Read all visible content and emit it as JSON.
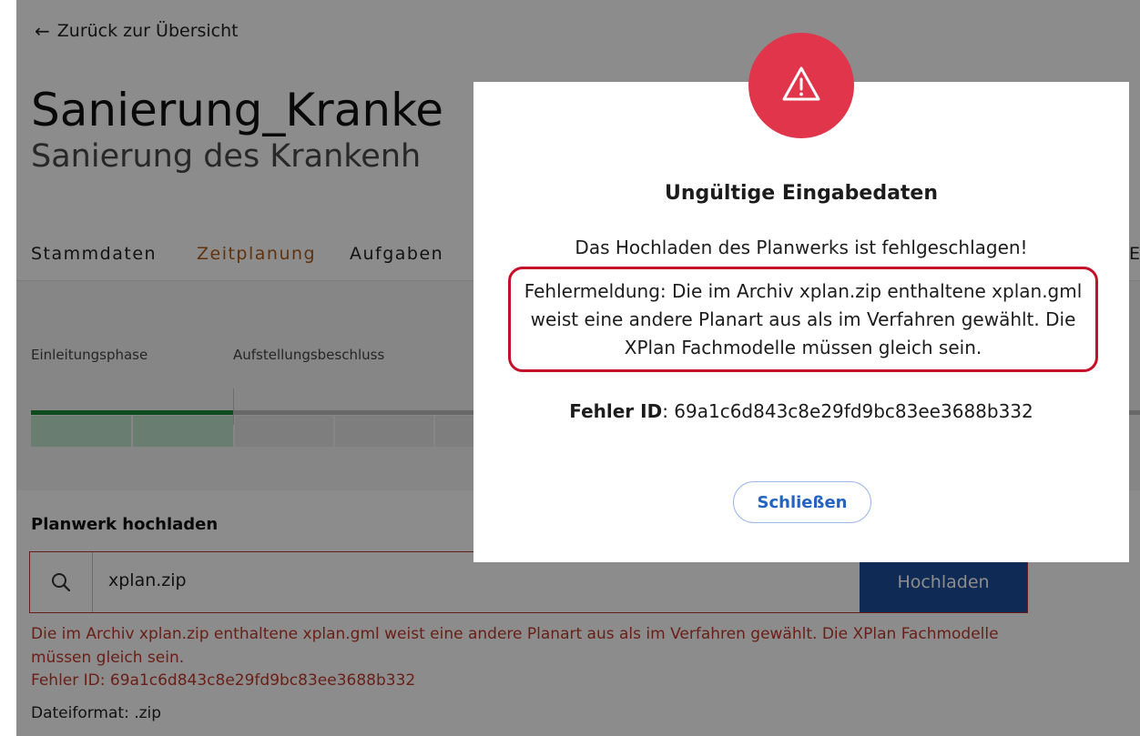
{
  "navigation": {
    "back_label": "Zurück zur Übersicht"
  },
  "project": {
    "title": "Sanierung_Kranke",
    "subtitle": "Sanierung des Krankenh"
  },
  "tabs": [
    {
      "label": "Stammdaten"
    },
    {
      "label": "Zeitplanung",
      "active": true
    },
    {
      "label": "Aufgaben"
    },
    {
      "label": "E"
    }
  ],
  "timeline": {
    "phases": [
      {
        "label": "Einleitungsphase"
      },
      {
        "label": "Aufstellungsbeschluss"
      }
    ]
  },
  "upload": {
    "section_title": "Planwerk hochladen",
    "file_value": "xplan.zip",
    "button_label": "Hochladen",
    "error_message": "Die im Archiv xplan.zip enthaltene xplan.gml weist eine andere Planart aus als im Verfahren gewählt. Die XPlan Fachmodelle müssen gleich sein.",
    "error_id_text": "Fehler ID: 69a1c6d843c8e29fd9bc83ee3688b332",
    "format_hint": "Dateiformat: .zip"
  },
  "modal": {
    "icon": "warning-triangle-icon",
    "title": "Ungültige Eingabedaten",
    "lead": "Das Hochladen des Planwerks ist fehlgeschlagen!",
    "message": "Fehlermeldung: Die im Archiv xplan.zip enthaltene xplan.gml weist eine andere Planart aus als im Verfahren gewählt. Die XPlan Fachmodelle müssen gleich sein.",
    "error_id_label": "Fehler ID",
    "error_id_value": ": 69a1c6d843c8e29fd9bc83ee3688b332",
    "close_label": "Schließen"
  },
  "colors": {
    "accent_tab": "#b05c1a",
    "primary_button": "#1d4e9c",
    "error": "#c0392b",
    "warning_circle": "#e0354a",
    "highlight_frame": "#c5102a"
  }
}
